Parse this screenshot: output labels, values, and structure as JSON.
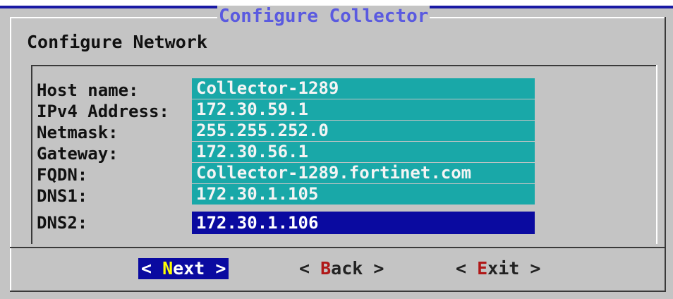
{
  "dialog": {
    "title": "Configure Collector",
    "subtitle": "Configure Network"
  },
  "form": {
    "fields": [
      {
        "label": "Host name:",
        "value": "Collector-1289"
      },
      {
        "label": "IPv4 Address:",
        "value": "172.30.59.1"
      },
      {
        "label": "Netmask:",
        "value": "255.255.252.0"
      },
      {
        "label": "Gateway:",
        "value": "172.30.56.1"
      },
      {
        "label": "FQDN:",
        "value": "Collector-1289.fortinet.com"
      },
      {
        "label": "DNS1:",
        "value": "172.30.1.105"
      },
      {
        "label": "DNS2:",
        "value": "172.30.1.106"
      }
    ],
    "selected_index": 6
  },
  "buttons": {
    "next": {
      "open": "< ",
      "hotkey": "N",
      "rest": "ext",
      "close": " >"
    },
    "back": {
      "open": "< ",
      "hotkey": "B",
      "rest": "ack",
      "close": " >"
    },
    "exit": {
      "open": "< ",
      "hotkey": "E",
      "rest": "xit",
      "close": " >"
    }
  },
  "colors": {
    "dialog_bg": "#c4c4c4",
    "field_bg": "#19a8a8",
    "selected_bg": "#0a0aa0",
    "title_color": "#5a5ae0",
    "hotkey_color": "#b01818",
    "active_hotkey_color": "#ffff00"
  }
}
